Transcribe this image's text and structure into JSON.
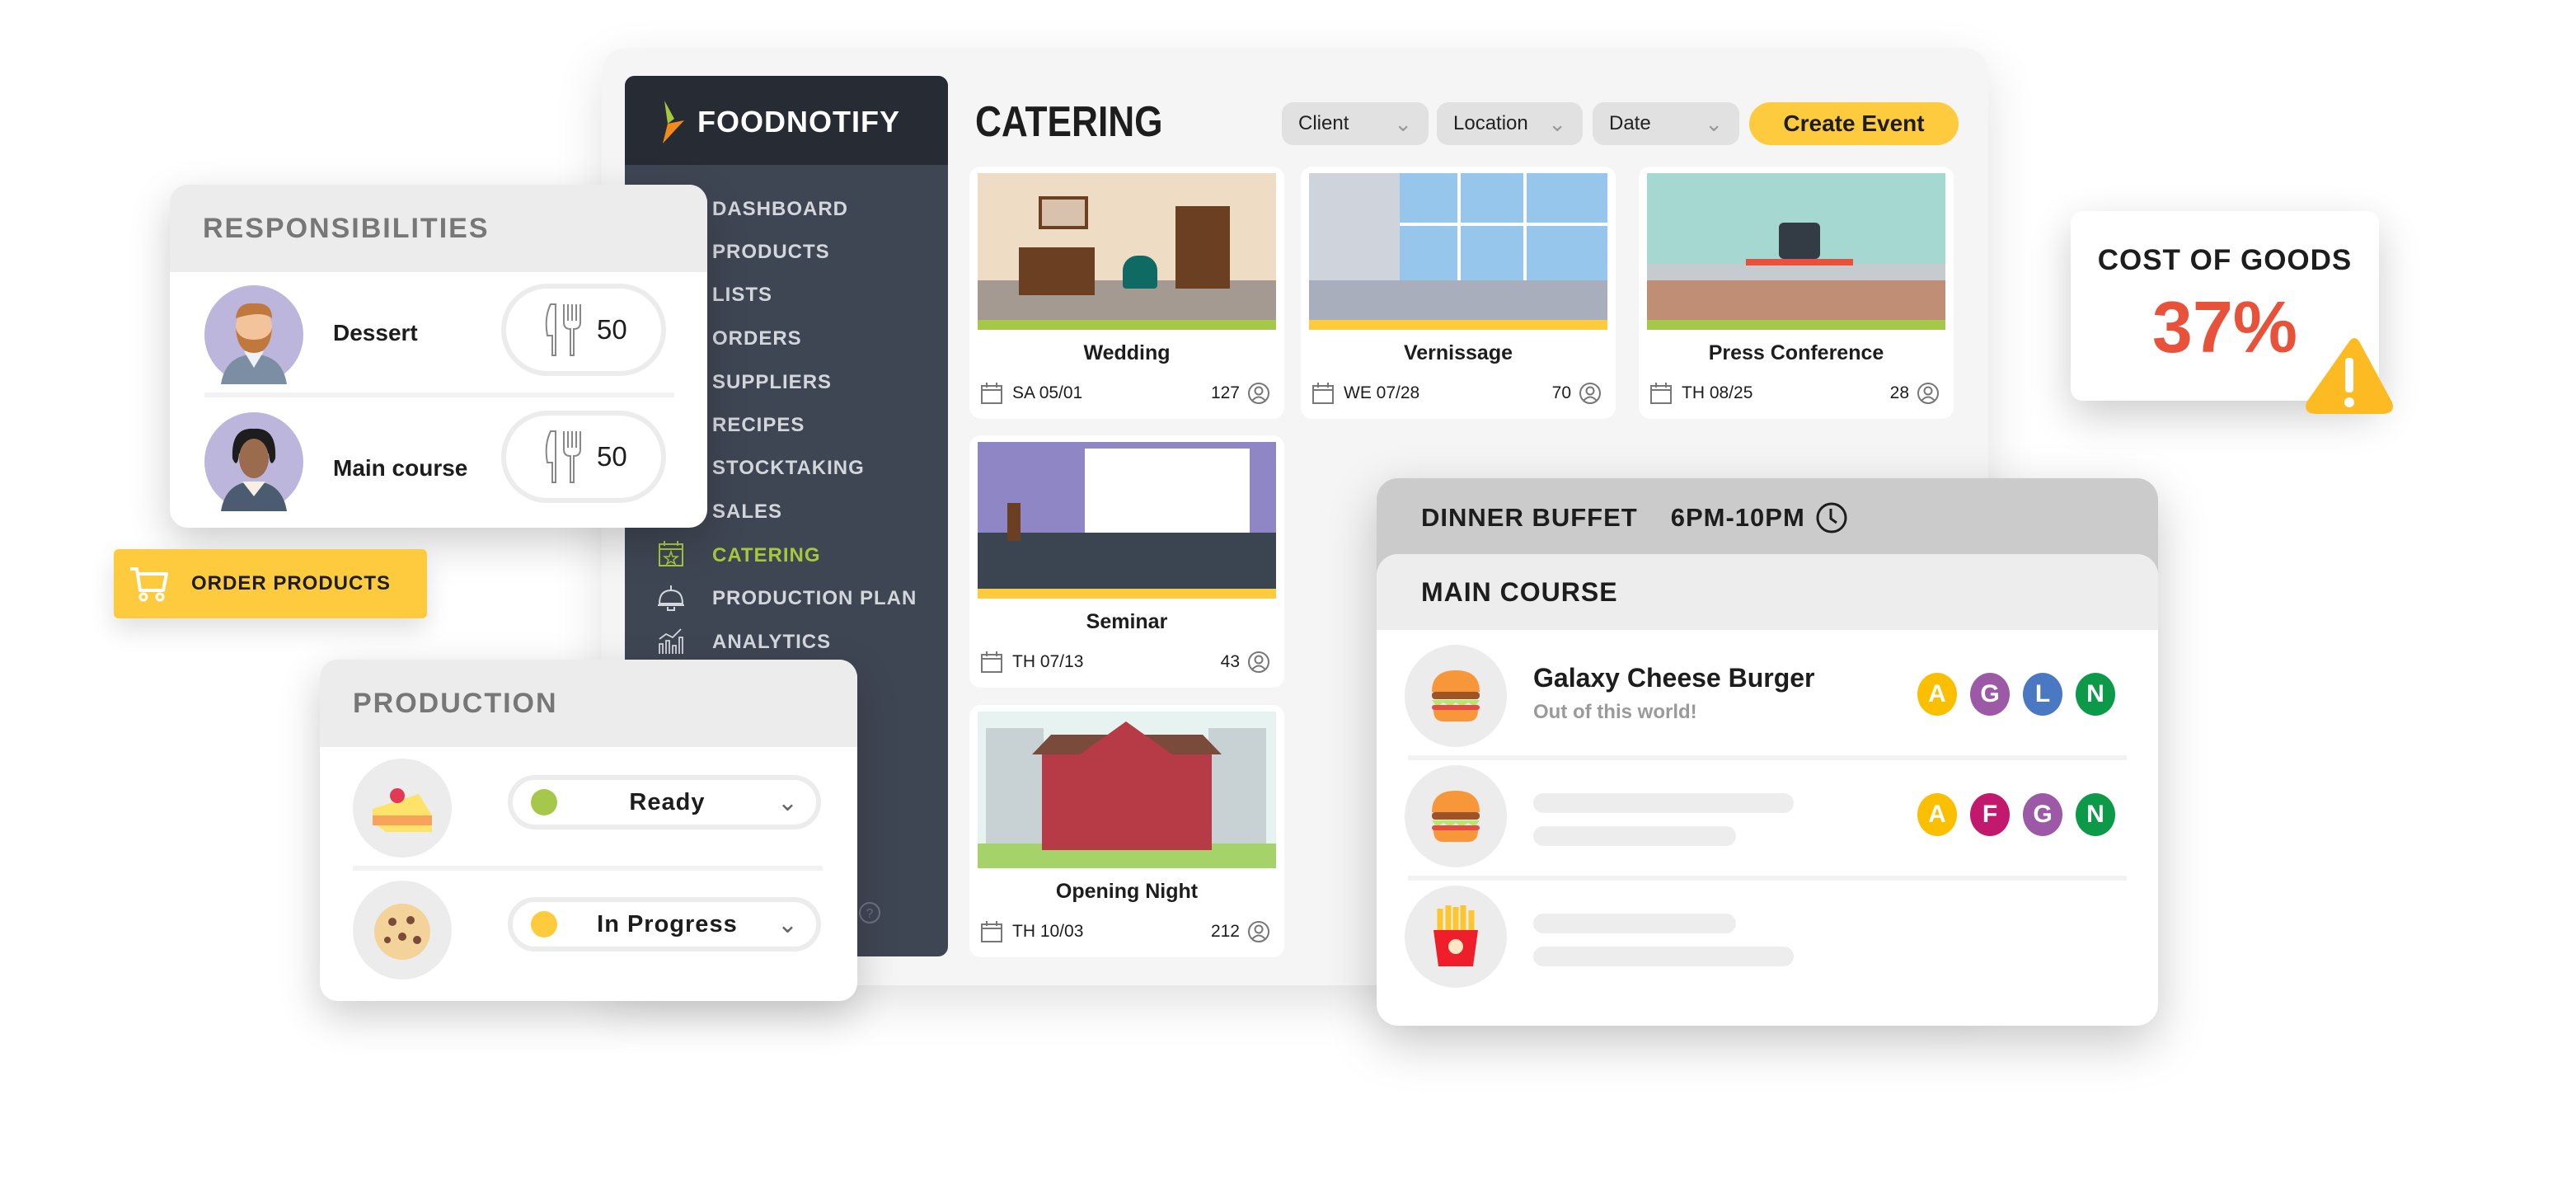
{
  "app": {
    "brand": "FOODNOTIFY",
    "page_title": "CATERING"
  },
  "sidebar": {
    "items": [
      {
        "label": "DASHBOARD"
      },
      {
        "label": "PRODUCTS"
      },
      {
        "label": "LISTS"
      },
      {
        "label": "ORDERS"
      },
      {
        "label": "SUPPLIERS"
      },
      {
        "label": "RECIPES"
      },
      {
        "label": "STOCKTAKING"
      },
      {
        "label": "SALES"
      },
      {
        "label": "CATERING",
        "icon": "calendar-star-icon",
        "active": true
      },
      {
        "label": "PRODUCTION PLAN",
        "icon": "service-bell-icon"
      },
      {
        "label": "ANALYTICS",
        "icon": "analytics-chart-icon"
      }
    ],
    "help_icon": "help-icon"
  },
  "filters": [
    {
      "label": "Client"
    },
    {
      "label": "Location"
    },
    {
      "label": "Date"
    }
  ],
  "create_event_label": "Create Event",
  "events": [
    {
      "name": "Wedding",
      "date": "SA 05/01",
      "guests": "127"
    },
    {
      "name": "Vernissage",
      "date": "WE 07/28",
      "guests": "70"
    },
    {
      "name": "Press Conference",
      "date": "TH 08/25",
      "guests": "28"
    },
    {
      "name": "Seminar",
      "date": "TH 07/13",
      "guests": "43"
    },
    {
      "name": "Opening Night",
      "date": "TH 10/03",
      "guests": "212"
    }
  ],
  "responsibilities": {
    "title": "RESPONSIBILITIES",
    "rows": [
      {
        "label": "Dessert",
        "count": "50"
      },
      {
        "label": "Main course",
        "count": "50"
      }
    ]
  },
  "order_products_label": "ORDER PRODUCTS",
  "production": {
    "title": "PRODUCTION",
    "rows": [
      {
        "item": "cake",
        "status": "Ready",
        "status_color": "#a6c84a"
      },
      {
        "item": "cookie",
        "status": "In Progress",
        "status_color": "#fdcb3c"
      }
    ]
  },
  "cost_of_goods": {
    "label": "COST OF GOODS",
    "value": "37%",
    "value_color": "#e8523a",
    "icon": "warning-icon"
  },
  "buffet": {
    "title": "DINNER BUFFET",
    "time": "6PM-10PM",
    "section": "MAIN COURSE",
    "rows": [
      {
        "name": "Galaxy Cheese Burger",
        "subtitle": "Out of this world!",
        "icon": "burger-icon",
        "allergens": [
          {
            "l": "A",
            "c": "#f9bf00"
          },
          {
            "l": "G",
            "c": "#9b59a6"
          },
          {
            "l": "L",
            "c": "#4a78c2"
          },
          {
            "l": "N",
            "c": "#0c9a48"
          }
        ]
      },
      {
        "icon": "burger-icon",
        "allergens": [
          {
            "l": "A",
            "c": "#f9bf00"
          },
          {
            "l": "F",
            "c": "#c2186d"
          },
          {
            "l": "G",
            "c": "#9b59a6"
          },
          {
            "l": "N",
            "c": "#0c9a48"
          }
        ]
      },
      {
        "icon": "fries-icon",
        "allergens": []
      }
    ]
  }
}
